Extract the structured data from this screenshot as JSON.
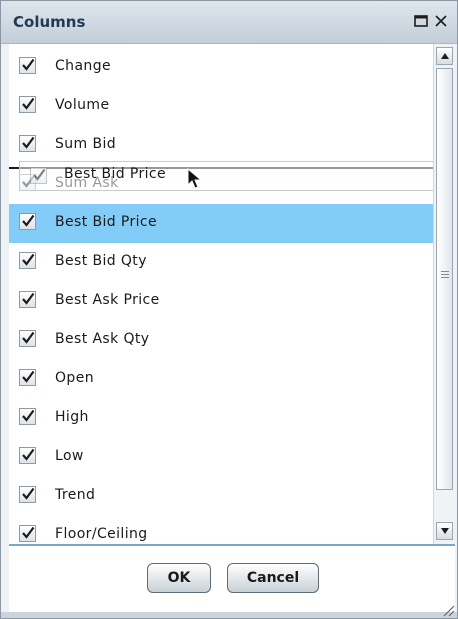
{
  "dialog": {
    "title": "Columns",
    "maximize_icon": "maximize-icon",
    "close_icon": "close-icon"
  },
  "list": {
    "items": [
      {
        "label": "Change",
        "checked": true
      },
      {
        "label": "Volume",
        "checked": true
      },
      {
        "label": "Sum Bid",
        "checked": true
      },
      {
        "label": "Sum Ask",
        "checked": true
      },
      {
        "label": "Best Bid Price",
        "checked": true,
        "selected": true
      },
      {
        "label": "Best Bid Qty",
        "checked": true
      },
      {
        "label": "Best Ask Price",
        "checked": true
      },
      {
        "label": "Best Ask Qty",
        "checked": true
      },
      {
        "label": "Open",
        "checked": true
      },
      {
        "label": "High",
        "checked": true
      },
      {
        "label": "Low",
        "checked": true
      },
      {
        "label": "Trend",
        "checked": true
      },
      {
        "label": "Floor/Ceiling",
        "checked": true
      }
    ],
    "drag_ghost_label": "Best Bid Price",
    "scroll_up_icon": "scroll-up-arrow-icon",
    "scroll_down_icon": "scroll-down-arrow-icon"
  },
  "footer": {
    "ok_label": "OK",
    "cancel_label": "Cancel"
  },
  "colors": {
    "selection": "#84ccf8",
    "title_text": "#1f3b55"
  }
}
